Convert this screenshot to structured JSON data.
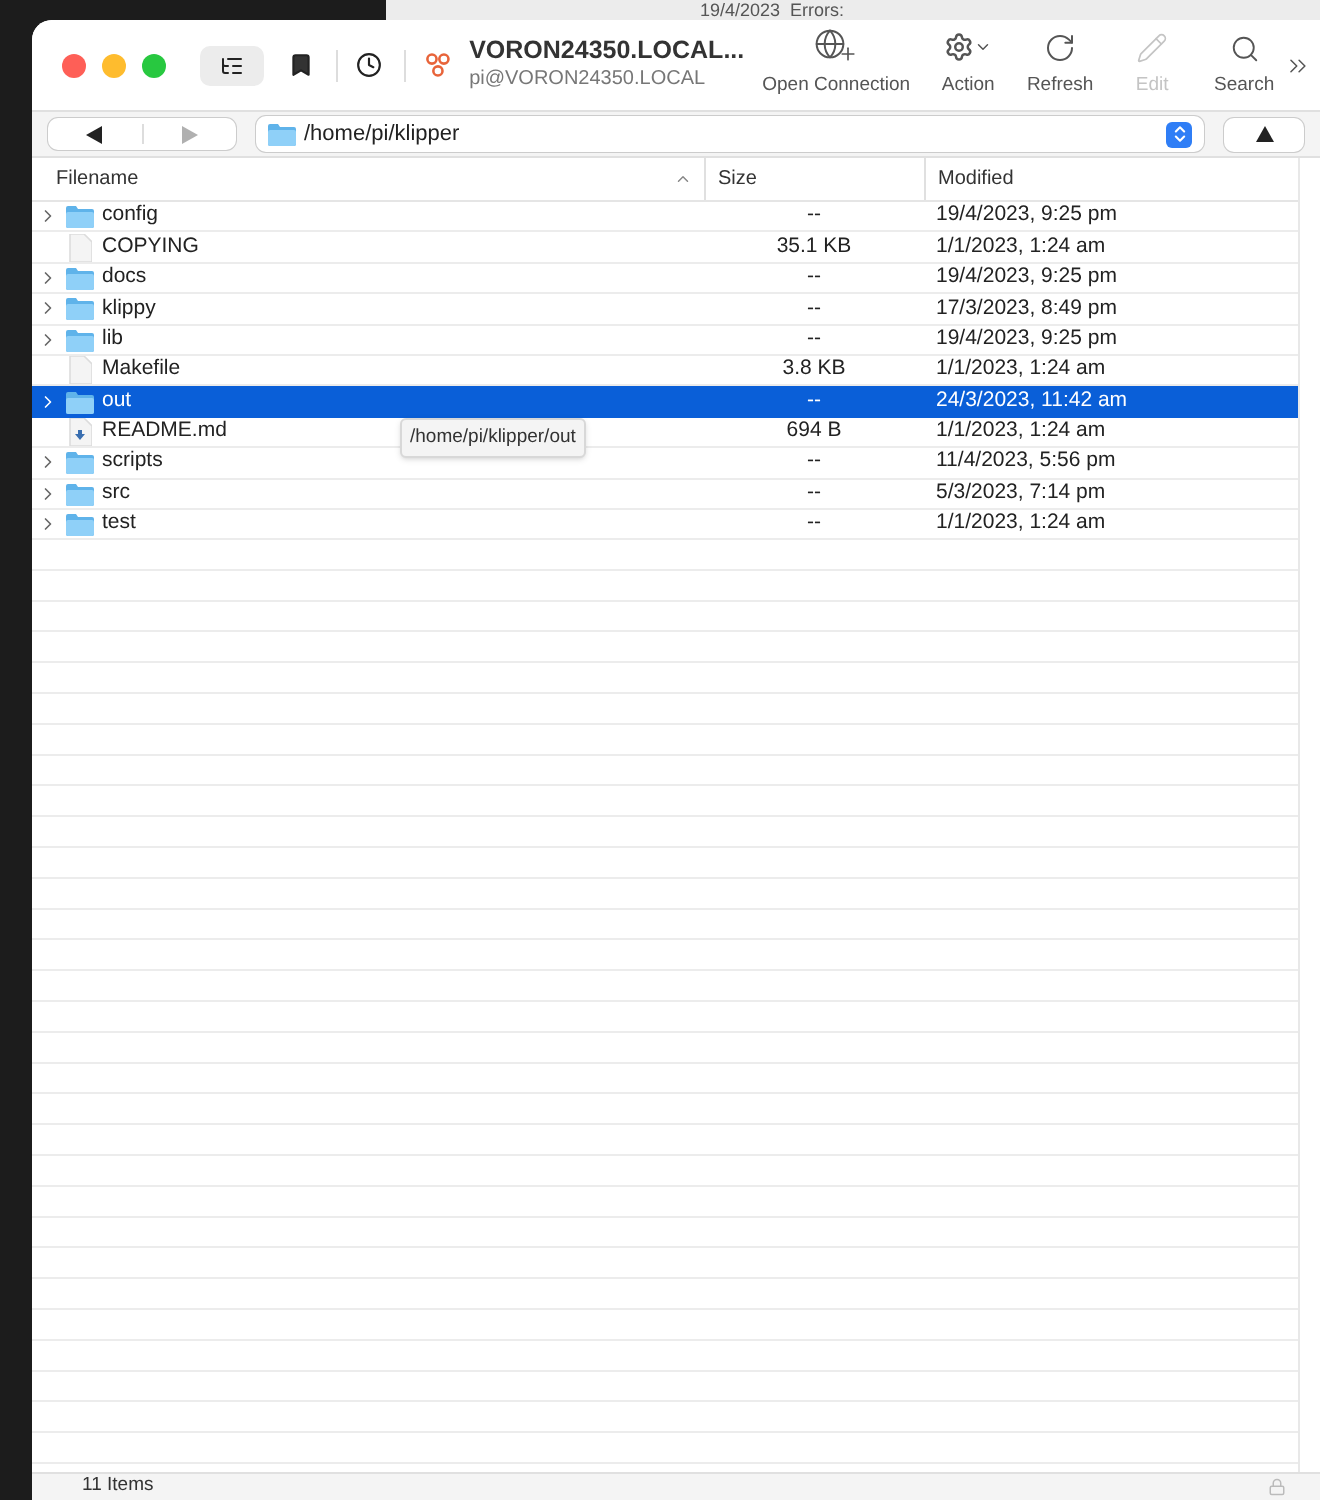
{
  "background": {
    "texts": [
      "19/4/2023",
      "Errors:"
    ]
  },
  "window": {
    "title": "VORON24350.LOCAL...",
    "subtitle": "pi@VORON24350.LOCAL"
  },
  "toolbar": [
    {
      "kind": "connect",
      "label": "Open Connection",
      "disabled": false
    },
    {
      "kind": "action",
      "label": "Action",
      "disabled": false
    },
    {
      "kind": "refresh",
      "label": "Refresh",
      "disabled": false
    },
    {
      "kind": "edit",
      "label": "Edit",
      "disabled": true
    },
    {
      "kind": "search",
      "label": "Search",
      "disabled": false
    }
  ],
  "path_bar": {
    "path": "/home/pi/klipper",
    "back_disabled": false,
    "forward_disabled": true
  },
  "table": {
    "columns": [
      {
        "label": "Filename",
        "sorted": true
      },
      {
        "label": "Size",
        "sorted": false
      },
      {
        "label": "Modified",
        "sorted": false
      }
    ],
    "rows": [
      {
        "name": "config",
        "size": "--",
        "modified": "19/4/2023, 9:25 pm",
        "kind": "folder",
        "selected": false
      },
      {
        "name": "COPYING",
        "size": "35.1 KB",
        "modified": "1/1/2023, 1:24 am",
        "kind": "file",
        "selected": false
      },
      {
        "name": "docs",
        "size": "--",
        "modified": "19/4/2023, 9:25 pm",
        "kind": "folder",
        "selected": false
      },
      {
        "name": "klippy",
        "size": "--",
        "modified": "17/3/2023, 8:49 pm",
        "kind": "folder",
        "selected": false
      },
      {
        "name": "lib",
        "size": "--",
        "modified": "19/4/2023, 9:25 pm",
        "kind": "folder",
        "selected": false
      },
      {
        "name": "Makefile",
        "size": "3.8 KB",
        "modified": "1/1/2023, 1:24 am",
        "kind": "file",
        "selected": false
      },
      {
        "name": "out",
        "size": "--",
        "modified": "24/3/2023, 11:42 am",
        "kind": "folder",
        "selected": true
      },
      {
        "name": "README.md",
        "size": "694 B",
        "modified": "1/1/2023, 1:24 am",
        "kind": "readme",
        "selected": false
      },
      {
        "name": "scripts",
        "size": "--",
        "modified": "11/4/2023, 5:56 pm",
        "kind": "folder",
        "selected": false
      },
      {
        "name": "src",
        "size": "--",
        "modified": "5/3/2023, 7:14 pm",
        "kind": "folder",
        "selected": false
      },
      {
        "name": "test",
        "size": "--",
        "modified": "1/1/2023, 1:24 am",
        "kind": "folder",
        "selected": false
      }
    ]
  },
  "tooltip": {
    "text": "/home/pi/klipper/out"
  },
  "status_bar": {
    "text": "11 Items"
  }
}
